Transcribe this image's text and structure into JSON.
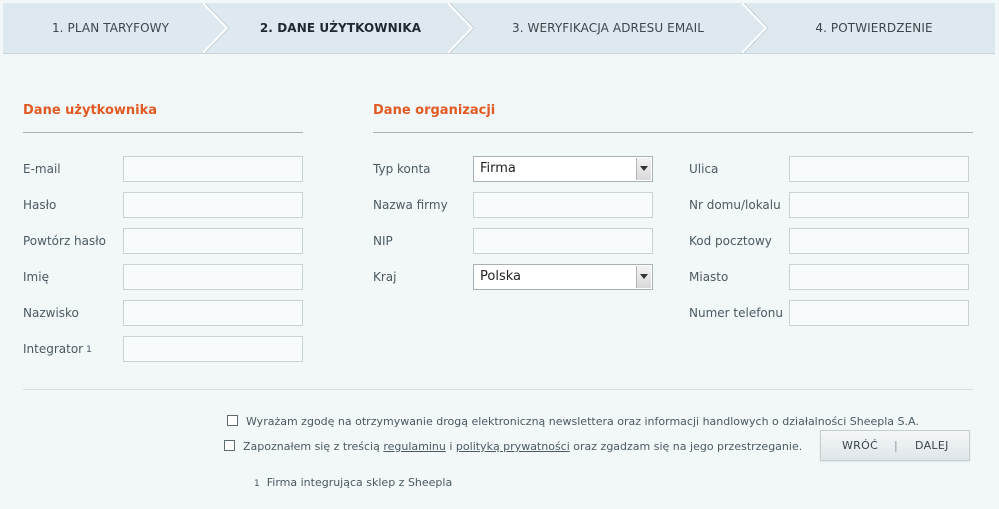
{
  "steps": [
    {
      "label": "1. PLAN TARYFOWY"
    },
    {
      "label": "2. DANE UŻYTKOWNIKA"
    },
    {
      "label": "3. WERYFIKACJA ADRESU EMAIL"
    },
    {
      "label": "4. POTWIERDZENIE"
    }
  ],
  "user_section": {
    "title": "Dane użytkownika",
    "fields": [
      {
        "label": "E-mail",
        "value": ""
      },
      {
        "label": "Hasło",
        "value": ""
      },
      {
        "label": "Powtórz hasło",
        "value": ""
      },
      {
        "label": "Imię",
        "value": ""
      },
      {
        "label": "Nazwisko",
        "value": ""
      },
      {
        "label": "Integrator",
        "sup": "1",
        "value": ""
      }
    ]
  },
  "org_section": {
    "title": "Dane organizacji",
    "account_type": {
      "label": "Typ konta",
      "value": "Firma"
    },
    "company_name": {
      "label": "Nazwa firmy",
      "value": ""
    },
    "nip": {
      "label": "NIP",
      "value": ""
    },
    "country": {
      "label": "Kraj",
      "value": "Polska"
    },
    "street": {
      "label": "Ulica",
      "value": ""
    },
    "house_number": {
      "label": "Nr domu/lokalu",
      "value": ""
    },
    "postal_code": {
      "label": "Kod pocztowy",
      "value": ""
    },
    "city": {
      "label": "Miasto",
      "value": ""
    },
    "phone": {
      "label": "Numer telefonu",
      "value": ""
    }
  },
  "consents": {
    "newsletter": "Wyrażam zgodę na otrzymywanie drogą elektroniczną newslettera oraz informacji handlowych o działalności Sheepla S.A.",
    "terms_before": "Zapoznałem się z treścią",
    "terms_link": "regulaminu",
    "terms_and": "i",
    "privacy_link": "polityką prywatności",
    "terms_after": "oraz zgadzam się na jego przestrzeganie."
  },
  "footnote": {
    "marker": "1",
    "text": "Firma integrująca sklep z Sheepla"
  },
  "buttons": {
    "back": "WRÓĆ",
    "separator": "|",
    "next": "DALEJ"
  },
  "colors": {
    "accent": "#e15a24",
    "steps_bg": "#dde9ee",
    "page_bg": "#f2f7f8"
  }
}
